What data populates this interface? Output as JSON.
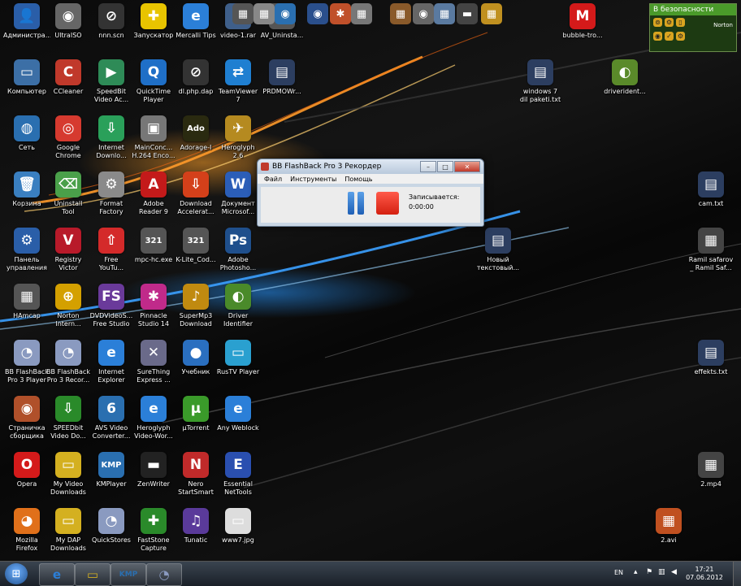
{
  "colors": {
    "accent": "#3b7fd4",
    "record_red": "#e0281a"
  },
  "desktop": {
    "icons": [
      {
        "label": "Администра...",
        "glyph": "👤",
        "color": "#2a5ea8"
      },
      {
        "label": "UltraISO",
        "glyph": "◉",
        "color": "#666666"
      },
      {
        "label": "nnn.scn",
        "glyph": "⊘",
        "color": "#333333"
      },
      {
        "label": "Запускатор",
        "glyph": "✚",
        "color": "#e8c400"
      },
      {
        "label": "Mercalli Tips",
        "glyph": "e",
        "color": "#2b7fd8"
      },
      {
        "label": "video-1.rar",
        "glyph": "▤",
        "color": "#3f5f8a"
      },
      {
        "label": "AV_Uninsta...",
        "glyph": "▦",
        "color": "#555555"
      },
      {
        "label": "bubble-tro...",
        "glyph": "M",
        "color": "#d41a1a"
      },
      {
        "label": "Компьютер",
        "glyph": "▭",
        "color": "#3c6fa6"
      },
      {
        "label": "CCleaner",
        "glyph": "C",
        "color": "#c0392b"
      },
      {
        "label": "SpeedBit\nVideo Ac...",
        "glyph": "▶",
        "color": "#2e8b57"
      },
      {
        "label": "QuickTime\nPlayer",
        "glyph": "Q",
        "color": "#1f6fc7"
      },
      {
        "label": "dl.php.dap",
        "glyph": "⊘",
        "color": "#333333"
      },
      {
        "label": "TeamViewer\n7",
        "glyph": "⇄",
        "color": "#1f7fd1"
      },
      {
        "label": "PRDMOWr...",
        "glyph": "▤",
        "color": "#2c3e60"
      },
      {
        "label": "windows 7\ndil paketi.txt",
        "glyph": "▤",
        "color": "#2c3e60"
      },
      {
        "label": "driverident...",
        "glyph": "◐",
        "color": "#5a8a2a"
      },
      {
        "label": "Сеть",
        "glyph": "◍",
        "color": "#2a6fb0"
      },
      {
        "label": "Google\nChrome",
        "glyph": "◎",
        "color": "#d63a2f"
      },
      {
        "label": "Internet\nDownlo...",
        "glyph": "⇩",
        "color": "#2aa05a"
      },
      {
        "label": "MainConc...\nH.264 Enco...",
        "glyph": "▣",
        "color": "#777777"
      },
      {
        "label": "Adorage-I",
        "glyph": "Ado",
        "color": "#2a2a10"
      },
      {
        "label": "Heroglyph\n2.6",
        "glyph": "✈",
        "color": "#b58a20"
      },
      {
        "label": "Корзина",
        "glyph": "🗑",
        "color": "#3a7fc0"
      },
      {
        "label": "Uninstall\nTool",
        "glyph": "⌫",
        "color": "#4aa04a"
      },
      {
        "label": "Format\nFactory",
        "glyph": "⚙",
        "color": "#8a8a8a"
      },
      {
        "label": "Adobe\nReader 9",
        "glyph": "A",
        "color": "#c41a1a"
      },
      {
        "label": "Download\nAccelerat...",
        "glyph": "⇩",
        "color": "#d4401a"
      },
      {
        "label": "Документ\nMicrosof...",
        "glyph": "W",
        "color": "#2b5eb8"
      },
      {
        "label": "cam.txt",
        "glyph": "▤",
        "color": "#2c3e60"
      },
      {
        "label": "Панель\nуправления",
        "glyph": "⚙",
        "color": "#2a5ea8"
      },
      {
        "label": "Registry\nVictor",
        "glyph": "V",
        "color": "#b81a2a"
      },
      {
        "label": "Free\nYouTu...",
        "glyph": "⇧",
        "color": "#d42a2a"
      },
      {
        "label": "mpc-hc.exe",
        "glyph": "321",
        "color": "#555555"
      },
      {
        "label": "K-Lite_Cod...",
        "glyph": "321",
        "color": "#555555"
      },
      {
        "label": "Adobe\nPhotosho...",
        "glyph": "Ps",
        "color": "#1f4f8c"
      },
      {
        "label": "Новый\nтекстовый...",
        "glyph": "▤",
        "color": "#2c3e60"
      },
      {
        "label": "Ramil safarov\n_ Ramil Saf...",
        "glyph": "▦",
        "color": "#444444"
      },
      {
        "label": "HAmcap",
        "glyph": "▦",
        "color": "#555555"
      },
      {
        "label": "Norton\nIntern...",
        "glyph": "⊕",
        "color": "#d4a000"
      },
      {
        "label": "DVDVideoS...\nFree Studio",
        "glyph": "FS",
        "color": "#6a3a9a"
      },
      {
        "label": "Pinnacle\nStudio 14",
        "glyph": "✱",
        "color": "#c02a8a"
      },
      {
        "label": "SuperMp3\nDownload",
        "glyph": "♪",
        "color": "#c08a10"
      },
      {
        "label": "Driver\nIdentifier",
        "glyph": "◐",
        "color": "#4a8a2a"
      },
      {
        "label": "BB FlashBack\nPro 3 Player",
        "glyph": "◔",
        "color": "#8a9ac0"
      },
      {
        "label": "BB FlashBack\nPro 3 Recor...",
        "glyph": "◔",
        "color": "#8a9ac0"
      },
      {
        "label": "Internet\nExplorer",
        "glyph": "e",
        "color": "#2b7fd8"
      },
      {
        "label": "SureThing\nExpress ...",
        "glyph": "✕",
        "color": "#6a6a8a"
      },
      {
        "label": "Учебник",
        "glyph": "●",
        "color": "#2a6fc0"
      },
      {
        "label": "RusTV Player",
        "glyph": "▭",
        "color": "#2aa0d0"
      },
      {
        "label": "effekts.txt",
        "glyph": "▤",
        "color": "#2c3e60"
      },
      {
        "label": "Страничка\nсборщика",
        "glyph": "◉",
        "color": "#b0502a"
      },
      {
        "label": "SPEEDbit\nVideo Do...",
        "glyph": "⇩",
        "color": "#2a8a2a"
      },
      {
        "label": "AVS Video\nConverter...",
        "glyph": "6",
        "color": "#2a6fb0"
      },
      {
        "label": "Heroglyph\nVideo-Wor...",
        "glyph": "e",
        "color": "#2b7fd8"
      },
      {
        "label": "µTorrent",
        "glyph": "µ",
        "color": "#3a9a2a"
      },
      {
        "label": "Any Weblock",
        "glyph": "e",
        "color": "#2b7fd8"
      },
      {
        "label": "Opera",
        "glyph": "O",
        "color": "#d41a1a"
      },
      {
        "label": "My Video\nDownloads",
        "glyph": "▭",
        "color": "#d4b020"
      },
      {
        "label": "KMPlayer",
        "glyph": "KMP",
        "color": "#2a6fb0"
      },
      {
        "label": "ZenWriter",
        "glyph": "▬",
        "color": "#222222"
      },
      {
        "label": "Nero\nStartSmart",
        "glyph": "N",
        "color": "#c02a2a"
      },
      {
        "label": "Essential\nNetTools",
        "glyph": "E",
        "color": "#2a4fb0"
      },
      {
        "label": "2.mp4",
        "glyph": "▦",
        "color": "#444444"
      },
      {
        "label": "Mozilla\nFirefox",
        "glyph": "◕",
        "color": "#e0701a"
      },
      {
        "label": "My DAP\nDownloads",
        "glyph": "▭",
        "color": "#d4b020"
      },
      {
        "label": "QuickStores",
        "glyph": "◔",
        "color": "#8a9ac0"
      },
      {
        "label": "FastStone\nCapture",
        "glyph": "✚",
        "color": "#2a8a2a"
      },
      {
        "label": "Tunatic",
        "glyph": "♫",
        "color": "#5a3a9a"
      },
      {
        "label": "www7.jpg",
        "glyph": "▭",
        "color": "#dddddd"
      },
      {
        "label": "2.avi",
        "glyph": "▦",
        "color": "#c05020"
      }
    ],
    "top_icons": [
      {
        "glyph": "▦",
        "color": "#555555"
      },
      {
        "glyph": "▦",
        "color": "#888888"
      },
      {
        "glyph": "◉",
        "color": "#2a6fb0"
      },
      {
        "glyph": "◉",
        "color": "#2a4f8c"
      },
      {
        "glyph": "✱",
        "color": "#c0502a"
      },
      {
        "glyph": "▦",
        "color": "#777777"
      },
      {
        "glyph": "▦",
        "color": "#8a5a2a"
      },
      {
        "glyph": "◉",
        "color": "#666666"
      },
      {
        "glyph": "▦",
        "color": "#5a7aa0"
      },
      {
        "glyph": "▬",
        "color": "#444444"
      },
      {
        "glyph": "▦",
        "color": "#c09020"
      }
    ]
  },
  "norton": {
    "status": "В безопасности",
    "brand": "Norton"
  },
  "recorder": {
    "title": "BB FlashBack Pro 3 Рекордер",
    "menu": [
      "Файл",
      "Инструменты",
      "Помощь"
    ],
    "status_label": "Записывается:",
    "elapsed": "0:00:00"
  },
  "taskbar": {
    "apps": [
      {
        "glyph": "e",
        "color": "#2b7fd8"
      },
      {
        "glyph": "▭",
        "color": "#d4b020"
      },
      {
        "glyph": "KMP",
        "color": "#2a6fb0"
      },
      {
        "glyph": "◔",
        "color": "#8a9ac0"
      }
    ],
    "language": "EN",
    "time": "17:21",
    "date": "07.06.2012"
  }
}
